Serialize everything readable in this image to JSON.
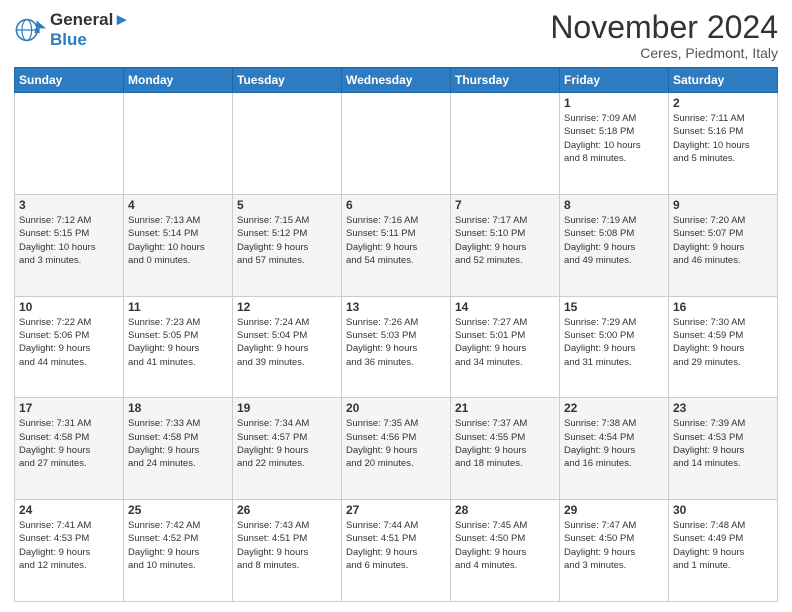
{
  "header": {
    "logo_line1": "General",
    "logo_line2": "Blue",
    "month": "November 2024",
    "location": "Ceres, Piedmont, Italy"
  },
  "weekdays": [
    "Sunday",
    "Monday",
    "Tuesday",
    "Wednesday",
    "Thursday",
    "Friday",
    "Saturday"
  ],
  "weeks": [
    [
      {
        "day": "",
        "info": ""
      },
      {
        "day": "",
        "info": ""
      },
      {
        "day": "",
        "info": ""
      },
      {
        "day": "",
        "info": ""
      },
      {
        "day": "",
        "info": ""
      },
      {
        "day": "1",
        "info": "Sunrise: 7:09 AM\nSunset: 5:18 PM\nDaylight: 10 hours\nand 8 minutes."
      },
      {
        "day": "2",
        "info": "Sunrise: 7:11 AM\nSunset: 5:16 PM\nDaylight: 10 hours\nand 5 minutes."
      }
    ],
    [
      {
        "day": "3",
        "info": "Sunrise: 7:12 AM\nSunset: 5:15 PM\nDaylight: 10 hours\nand 3 minutes."
      },
      {
        "day": "4",
        "info": "Sunrise: 7:13 AM\nSunset: 5:14 PM\nDaylight: 10 hours\nand 0 minutes."
      },
      {
        "day": "5",
        "info": "Sunrise: 7:15 AM\nSunset: 5:12 PM\nDaylight: 9 hours\nand 57 minutes."
      },
      {
        "day": "6",
        "info": "Sunrise: 7:16 AM\nSunset: 5:11 PM\nDaylight: 9 hours\nand 54 minutes."
      },
      {
        "day": "7",
        "info": "Sunrise: 7:17 AM\nSunset: 5:10 PM\nDaylight: 9 hours\nand 52 minutes."
      },
      {
        "day": "8",
        "info": "Sunrise: 7:19 AM\nSunset: 5:08 PM\nDaylight: 9 hours\nand 49 minutes."
      },
      {
        "day": "9",
        "info": "Sunrise: 7:20 AM\nSunset: 5:07 PM\nDaylight: 9 hours\nand 46 minutes."
      }
    ],
    [
      {
        "day": "10",
        "info": "Sunrise: 7:22 AM\nSunset: 5:06 PM\nDaylight: 9 hours\nand 44 minutes."
      },
      {
        "day": "11",
        "info": "Sunrise: 7:23 AM\nSunset: 5:05 PM\nDaylight: 9 hours\nand 41 minutes."
      },
      {
        "day": "12",
        "info": "Sunrise: 7:24 AM\nSunset: 5:04 PM\nDaylight: 9 hours\nand 39 minutes."
      },
      {
        "day": "13",
        "info": "Sunrise: 7:26 AM\nSunset: 5:03 PM\nDaylight: 9 hours\nand 36 minutes."
      },
      {
        "day": "14",
        "info": "Sunrise: 7:27 AM\nSunset: 5:01 PM\nDaylight: 9 hours\nand 34 minutes."
      },
      {
        "day": "15",
        "info": "Sunrise: 7:29 AM\nSunset: 5:00 PM\nDaylight: 9 hours\nand 31 minutes."
      },
      {
        "day": "16",
        "info": "Sunrise: 7:30 AM\nSunset: 4:59 PM\nDaylight: 9 hours\nand 29 minutes."
      }
    ],
    [
      {
        "day": "17",
        "info": "Sunrise: 7:31 AM\nSunset: 4:58 PM\nDaylight: 9 hours\nand 27 minutes."
      },
      {
        "day": "18",
        "info": "Sunrise: 7:33 AM\nSunset: 4:58 PM\nDaylight: 9 hours\nand 24 minutes."
      },
      {
        "day": "19",
        "info": "Sunrise: 7:34 AM\nSunset: 4:57 PM\nDaylight: 9 hours\nand 22 minutes."
      },
      {
        "day": "20",
        "info": "Sunrise: 7:35 AM\nSunset: 4:56 PM\nDaylight: 9 hours\nand 20 minutes."
      },
      {
        "day": "21",
        "info": "Sunrise: 7:37 AM\nSunset: 4:55 PM\nDaylight: 9 hours\nand 18 minutes."
      },
      {
        "day": "22",
        "info": "Sunrise: 7:38 AM\nSunset: 4:54 PM\nDaylight: 9 hours\nand 16 minutes."
      },
      {
        "day": "23",
        "info": "Sunrise: 7:39 AM\nSunset: 4:53 PM\nDaylight: 9 hours\nand 14 minutes."
      }
    ],
    [
      {
        "day": "24",
        "info": "Sunrise: 7:41 AM\nSunset: 4:53 PM\nDaylight: 9 hours\nand 12 minutes."
      },
      {
        "day": "25",
        "info": "Sunrise: 7:42 AM\nSunset: 4:52 PM\nDaylight: 9 hours\nand 10 minutes."
      },
      {
        "day": "26",
        "info": "Sunrise: 7:43 AM\nSunset: 4:51 PM\nDaylight: 9 hours\nand 8 minutes."
      },
      {
        "day": "27",
        "info": "Sunrise: 7:44 AM\nSunset: 4:51 PM\nDaylight: 9 hours\nand 6 minutes."
      },
      {
        "day": "28",
        "info": "Sunrise: 7:45 AM\nSunset: 4:50 PM\nDaylight: 9 hours\nand 4 minutes."
      },
      {
        "day": "29",
        "info": "Sunrise: 7:47 AM\nSunset: 4:50 PM\nDaylight: 9 hours\nand 3 minutes."
      },
      {
        "day": "30",
        "info": "Sunrise: 7:48 AM\nSunset: 4:49 PM\nDaylight: 9 hours\nand 1 minute."
      }
    ]
  ]
}
